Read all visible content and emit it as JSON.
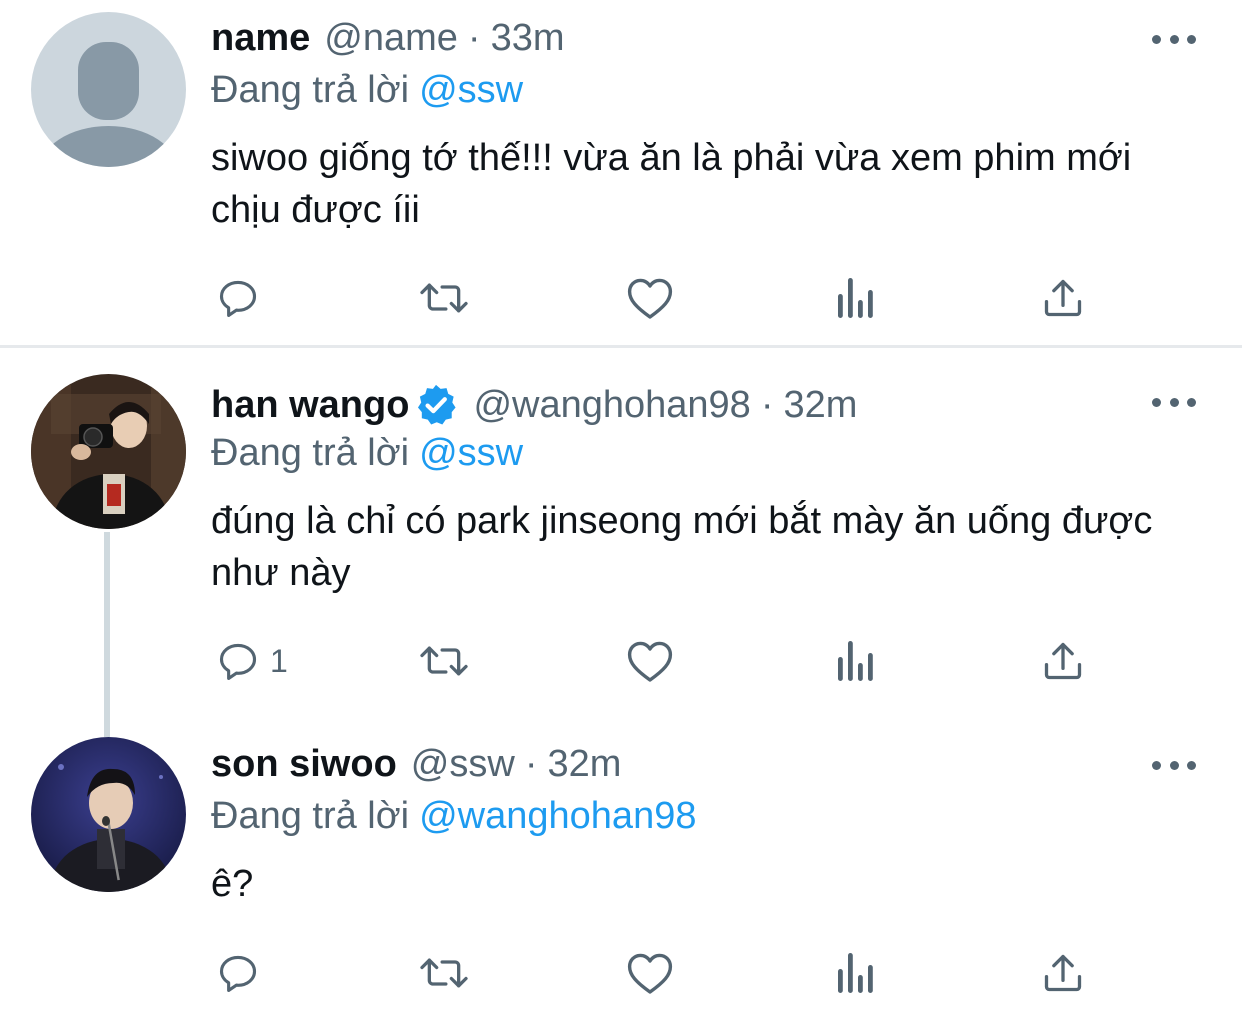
{
  "tweets": [
    {
      "name": "name",
      "handle": "@name",
      "separator": "·",
      "time": "33m",
      "verified": false,
      "avatar": "default-avatar",
      "replying_prefix": "Đang trả lời",
      "replying_to": "@ssw",
      "text": "siwoo giống tớ thế!!! vừa ăn là phải vừa xem phim mới chịu được íii",
      "reply_count": ""
    },
    {
      "name": "han wango",
      "handle": "@wanghohan98",
      "separator": "·",
      "time": "32m",
      "verified": true,
      "avatar": "photo-avatar-camera",
      "replying_prefix": "Đang trả lời",
      "replying_to": "@ssw",
      "text": "đúng là chỉ có park jinseong mới bắt mày ăn uống được như này",
      "reply_count": "1"
    },
    {
      "name": "son siwoo",
      "handle": "@ssw",
      "separator": "·",
      "time": "32m",
      "verified": false,
      "avatar": "photo-avatar-stage",
      "replying_prefix": "Đang trả lời",
      "replying_to": "@wanghohan98",
      "text": "ê?",
      "reply_count": ""
    }
  ],
  "icons": {
    "reply": "reply-icon",
    "retweet": "retweet-icon",
    "like": "heart-icon",
    "analytics": "analytics-icon",
    "share": "share-icon",
    "more": "more-icon",
    "verified": "verified-badge-icon"
  },
  "colors": {
    "text": "#0f1419",
    "secondary": "#536471",
    "link": "#1d9bf0",
    "divider": "#e6e9ec"
  }
}
